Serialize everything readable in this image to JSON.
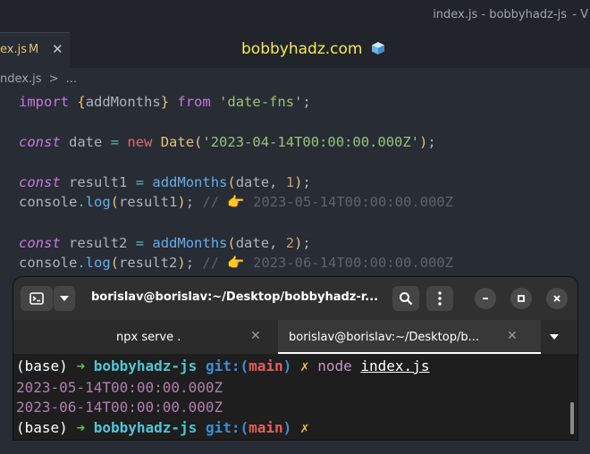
{
  "window": {
    "title": "index.js - bobbyhadz-js",
    "title_extra": "- V"
  },
  "tab": {
    "name": "ex.js",
    "modified": "M",
    "close": "✕"
  },
  "watermark": "bobbyhadz.com",
  "breadcrumb": {
    "file": "ndex.js",
    "sep": ">",
    "rest": "..."
  },
  "code": {
    "l1": {
      "import": "import",
      "b1": "{",
      "name": "addMonths",
      "b2": "}",
      "from": "from",
      "mod": "'date-fns'",
      "semi": ";"
    },
    "l2": {
      "const": "const",
      "var": "date",
      "eq": "=",
      "new": "new",
      "cls": "Date",
      "p1": "(",
      "str": "'2023-04-14T00:00:00.000Z'",
      "p2": ")",
      "semi": ";"
    },
    "l3": {
      "const": "const",
      "var": "result1",
      "eq": "=",
      "fn": "addMonths",
      "p1": "(",
      "arg": "date",
      "comma": ", ",
      "num": "1",
      "p2": ")",
      "semi": ";"
    },
    "l4": {
      "obj": "console",
      "dot": ".",
      "fn": "log",
      "p1": "(",
      "arg": "result1",
      "p2": ")",
      "semi": ";",
      "comment": "// 👉 2023-05-14T00:00:00.000Z"
    },
    "l5": {
      "const": "const",
      "var": "result2",
      "eq": "=",
      "fn": "addMonths",
      "p1": "(",
      "arg": "date",
      "comma": ", ",
      "num": "2",
      "p2": ")",
      "semi": ";"
    },
    "l6": {
      "obj": "console",
      "dot": ".",
      "fn": "log",
      "p1": "(",
      "arg": "result2",
      "p2": ")",
      "semi": ";",
      "comment": "// 👉 2023-06-14T00:00:00.000Z"
    }
  },
  "terminal": {
    "title": "borislav@borislav:~/Desktop/bobbyhadz-r...",
    "tabs": [
      {
        "label": "npx serve .",
        "close": "✕"
      },
      {
        "label": "borislav@borislav:~/Desktop/b...",
        "close": "✕"
      }
    ],
    "prompt": {
      "env": "(base)",
      "arrow": "➜",
      "dir": "bobbyhadz-js",
      "git": "git:(",
      "branch": "main",
      "git_close": ")",
      "dirty": "✗"
    },
    "cmd": "node",
    "file": "index.js",
    "output": [
      "2023-05-14T00:00:00.000Z",
      "2023-06-14T00:00:00.000Z"
    ]
  }
}
